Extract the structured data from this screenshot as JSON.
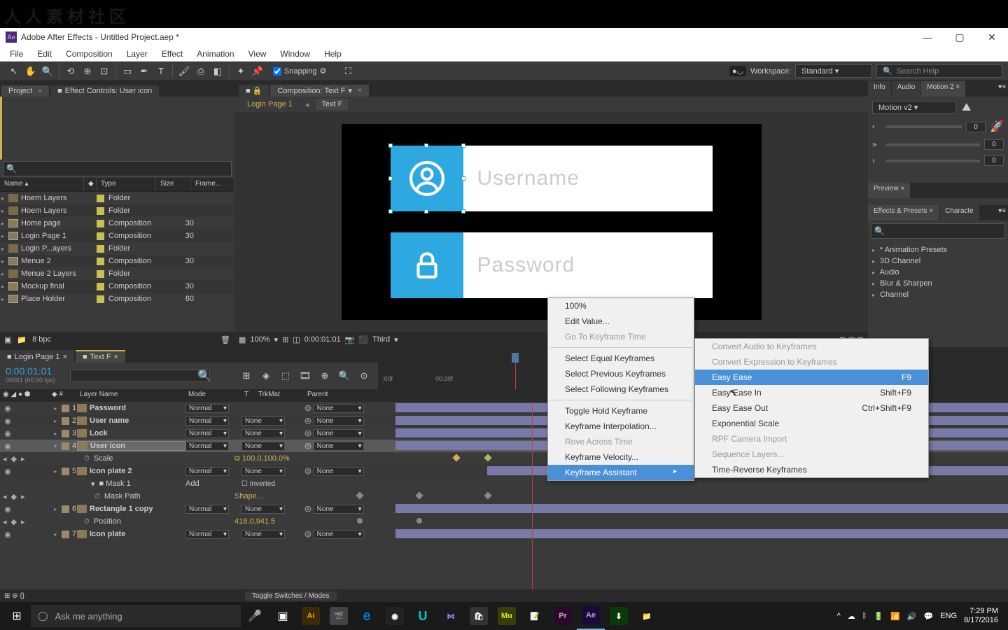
{
  "window": {
    "title": "Adobe After Effects - Untitled Project.aep *",
    "ae_badge": "Ae"
  },
  "menubar": [
    "File",
    "Edit",
    "Composition",
    "Layer",
    "Effect",
    "Animation",
    "View",
    "Window",
    "Help"
  ],
  "toolbar": {
    "snapping": "Snapping",
    "workspace_label": "Workspace:",
    "workspace_value": "Standard",
    "search_placeholder": "Search Help"
  },
  "left": {
    "tabs": [
      "Project",
      "Effect Controls: User icon"
    ],
    "headers": {
      "name": "Name",
      "type": "Type",
      "size": "Size",
      "frame": "Frame..."
    },
    "rows": [
      {
        "name": "Hoem Layers",
        "type": "Folder",
        "size": "",
        "icon": "folder"
      },
      {
        "name": "Hoem Layers",
        "type": "Folder",
        "size": "",
        "icon": "folder"
      },
      {
        "name": "Home page",
        "type": "Composition",
        "size": "30",
        "icon": "comp"
      },
      {
        "name": "Login Page 1",
        "type": "Composition",
        "size": "30",
        "icon": "comp"
      },
      {
        "name": "Login P...ayers",
        "type": "Folder",
        "size": "",
        "icon": "folder"
      },
      {
        "name": "Menue 2",
        "type": "Composition",
        "size": "30",
        "icon": "comp"
      },
      {
        "name": "Menue 2 Layers",
        "type": "Folder",
        "size": "",
        "icon": "folder"
      },
      {
        "name": "Mockup final",
        "type": "Composition",
        "size": "30",
        "icon": "comp"
      },
      {
        "name": "Place Holder",
        "type": "Composition",
        "size": "60",
        "icon": "comp"
      }
    ],
    "footer_bpc": "8 bpc"
  },
  "center": {
    "comp_tab": "Composition: Text F",
    "breadcrumbs": [
      "Login Page 1",
      "Text F"
    ],
    "canvas": {
      "username_label": "Username",
      "password_label": "Password"
    },
    "footer": {
      "zoom": "100%",
      "time": "0:00:01:01",
      "quality": "Third"
    }
  },
  "right": {
    "tabs1": [
      "Info",
      "Audio",
      "Motion 2"
    ],
    "motion_preset": "Motion v2",
    "slider_vals": [
      "0",
      "0",
      "0"
    ],
    "preview_tab": "Preview",
    "tabs2": [
      "Effects & Presets",
      "Characte"
    ],
    "presets": [
      "* Animation Presets",
      "3D Channel",
      "Audio",
      "Blur & Sharpen",
      "Channel"
    ]
  },
  "timeline": {
    "tabs": [
      "Login Page 1",
      "Text F"
    ],
    "timecode": "0:00:01:01",
    "framecode": "00061 (60.00 fps)",
    "colheads": {
      "layername": "Layer Name",
      "mode": "Mode",
      "t": "T",
      "trkmat": "TrkMat",
      "parent": "Parent"
    },
    "ruler_ticks": [
      ":00f",
      "00:30f"
    ],
    "layers": [
      {
        "num": "1",
        "name": "Password",
        "mode": "Normal",
        "trkmat": "",
        "parent": "None",
        "bar": [
          0,
          100
        ]
      },
      {
        "num": "2",
        "name": "User name",
        "mode": "Normal",
        "trkmat": "None",
        "parent": "None",
        "bar": [
          0,
          100
        ]
      },
      {
        "num": "3",
        "name": "Lock",
        "mode": "Normal",
        "trkmat": "None",
        "parent": "None",
        "bar": [
          0,
          100
        ]
      },
      {
        "num": "4",
        "name": "User icon",
        "mode": "Normal",
        "trkmat": "None",
        "parent": "None",
        "bar": [
          0,
          100
        ],
        "selected": true,
        "expanded": true
      },
      {
        "num": "5",
        "name": "Icon plate 2",
        "mode": "Normal",
        "trkmat": "None",
        "parent": "None",
        "bar": [
          15,
          100
        ]
      },
      {
        "num": "6",
        "name": "Rectangle 1 copy",
        "mode": "Normal",
        "trkmat": "None",
        "parent": "None",
        "bar": [
          0,
          100
        ]
      },
      {
        "num": "7",
        "name": "Icon plate",
        "mode": "Normal",
        "trkmat": "None",
        "parent": "None",
        "bar": [
          0,
          100
        ]
      }
    ],
    "props": {
      "scale": {
        "name": "Scale",
        "value": "100.0,100.0%"
      },
      "mask1": "Mask 1",
      "mask_mode": "Add",
      "inverted": "Inverted",
      "maskpath": {
        "name": "Mask Path",
        "value": "Shape..."
      },
      "position": {
        "name": "Position",
        "value": "418.0,941.5"
      }
    },
    "footer": "Toggle Switches / Modes"
  },
  "context_menu1": {
    "items": [
      {
        "label": "100%"
      },
      {
        "label": "Edit Value..."
      },
      {
        "label": "Go To Keyframe Time",
        "disabled": true
      },
      {
        "sep": true
      },
      {
        "label": "Select Equal Keyframes"
      },
      {
        "label": "Select Previous Keyframes"
      },
      {
        "label": "Select Following Keyframes"
      },
      {
        "sep": true
      },
      {
        "label": "Toggle Hold Keyframe"
      },
      {
        "label": "Keyframe Interpolation..."
      },
      {
        "label": "Rove Across Time",
        "disabled": true
      },
      {
        "label": "Keyframe Velocity..."
      },
      {
        "label": "Keyframe Assistant",
        "submenu": true,
        "highlight": true
      }
    ]
  },
  "context_menu2": {
    "items": [
      {
        "label": "Convert Audio to Keyframes",
        "disabled": true
      },
      {
        "label": "Convert Expression to Keyframes",
        "disabled": true
      },
      {
        "label": "Easy Ease",
        "shortcut": "F9",
        "highlight": true
      },
      {
        "label": "Easy Ease In",
        "shortcut": "Shift+F9"
      },
      {
        "label": "Easy Ease Out",
        "shortcut": "Ctrl+Shift+F9"
      },
      {
        "label": "Exponential Scale"
      },
      {
        "label": "RPF Camera Import",
        "disabled": true
      },
      {
        "label": "Sequence Layers...",
        "disabled": true
      },
      {
        "label": "Time-Reverse Keyframes"
      }
    ]
  },
  "taskbar": {
    "cortana": "Ask me anything",
    "lang": "ENG",
    "time": "7:29 PM",
    "date": "8/17/2016"
  },
  "watermark": "人人素材社区"
}
